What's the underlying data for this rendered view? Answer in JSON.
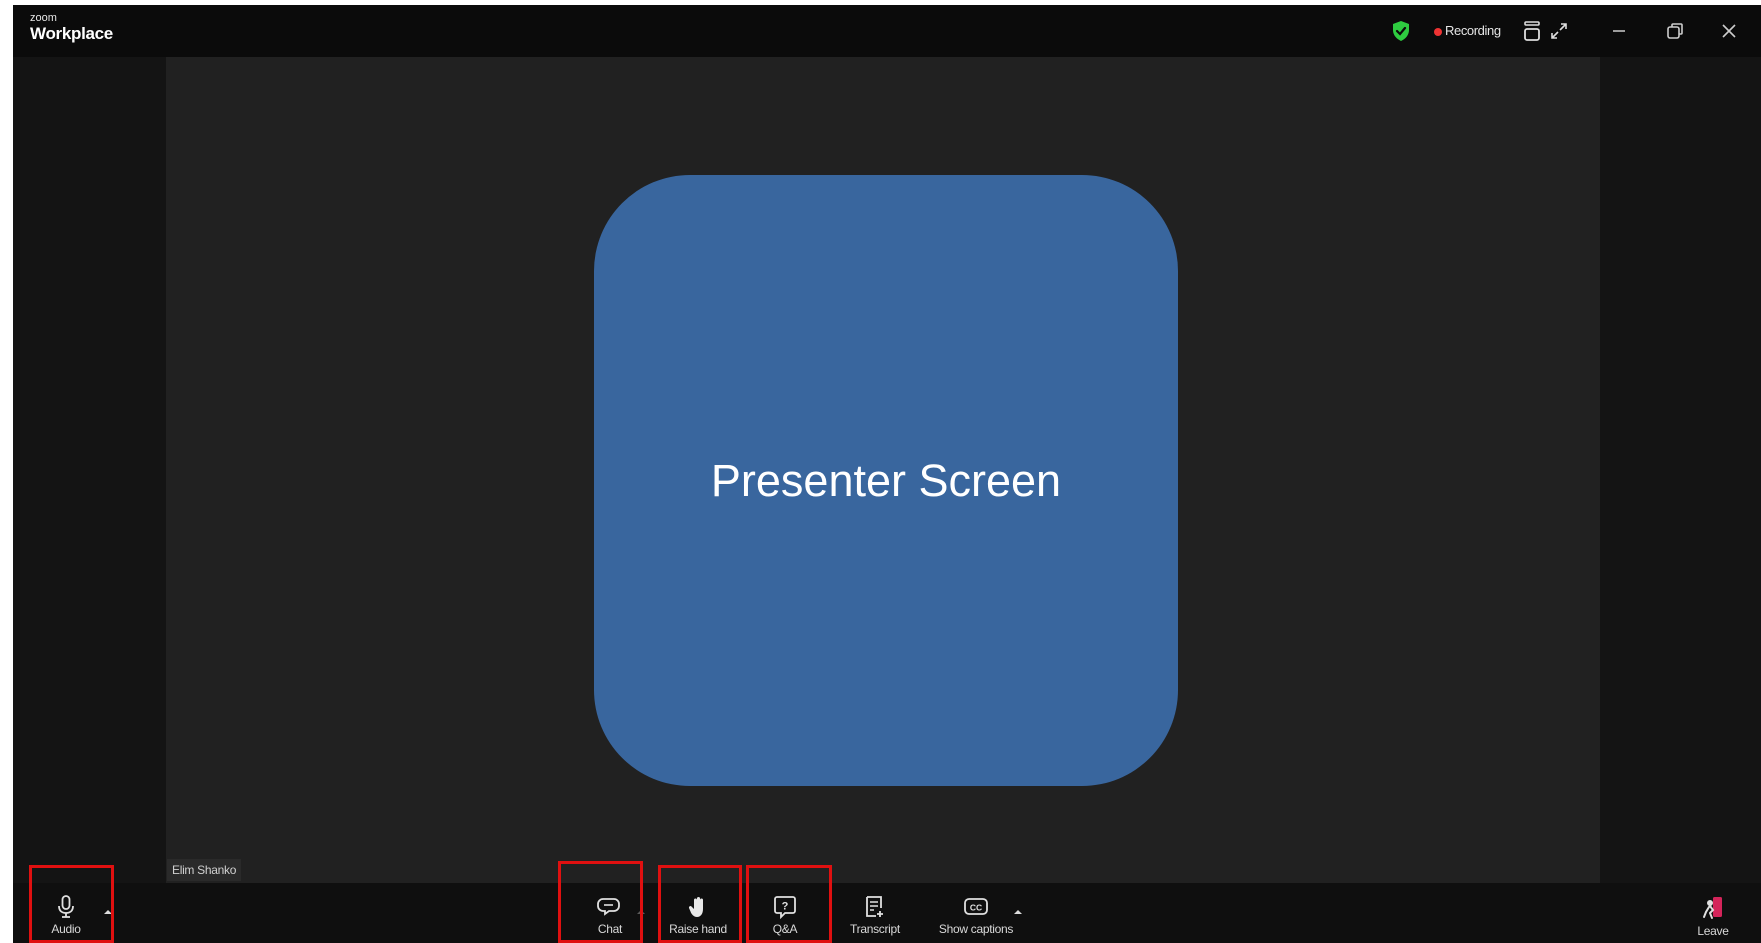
{
  "app": {
    "brand_small": "zoom",
    "brand_name": "Workplace"
  },
  "titlebar": {
    "recording_label": "Recording",
    "icons": [
      "shield-check-icon",
      "recording-dot-icon",
      "view-layout-icon",
      "fullscreen-icon",
      "minimize-icon",
      "restore-icon",
      "close-icon"
    ],
    "colors": {
      "shield": "#2ecc40",
      "recording_dot": "#e33333"
    }
  },
  "stage": {
    "presenter_label": "Presenter Screen",
    "participant_name": "Elim Shanko",
    "colors": {
      "presenter_tile": "#39669e",
      "stage_bg": "#212121"
    }
  },
  "toolbar": {
    "audio_label": "Audio",
    "chat_label": "Chat",
    "raise_hand_label": "Raise hand",
    "qa_label": "Q&A",
    "transcript_label": "Transcript",
    "captions_label": "Show captions",
    "leave_label": "Leave",
    "highlight_color": "#e01010",
    "highlighted": [
      "Audio",
      "Chat",
      "Raise hand",
      "Q&A"
    ]
  }
}
